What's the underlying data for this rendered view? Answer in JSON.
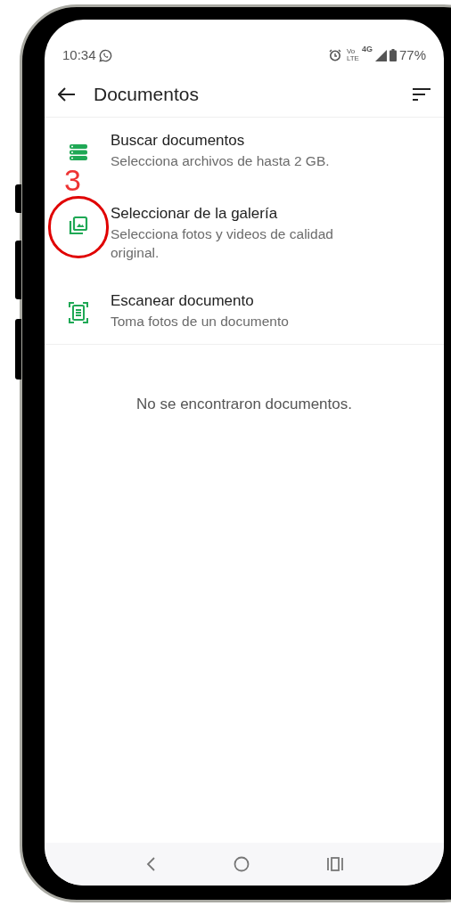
{
  "status_bar": {
    "time": "10:34",
    "volte": [
      "Vo",
      "LTE"
    ],
    "network": "4G",
    "battery": "77%"
  },
  "header": {
    "title": "Documentos"
  },
  "options": [
    {
      "kind": "files",
      "title": "Buscar documentos",
      "subtitle": "Selecciona archivos de hasta 2 GB.",
      "circled": false
    },
    {
      "kind": "gallery",
      "title": "Seleccionar de la galería",
      "subtitle": "Selecciona fotos y videos de calidad original.",
      "circled": true
    },
    {
      "kind": "scan",
      "title": "Escanear documento",
      "subtitle": "Toma fotos de un documento",
      "circled": false
    }
  ],
  "empty_message": "No se encontraron documentos.",
  "annotation": {
    "label": "3"
  }
}
